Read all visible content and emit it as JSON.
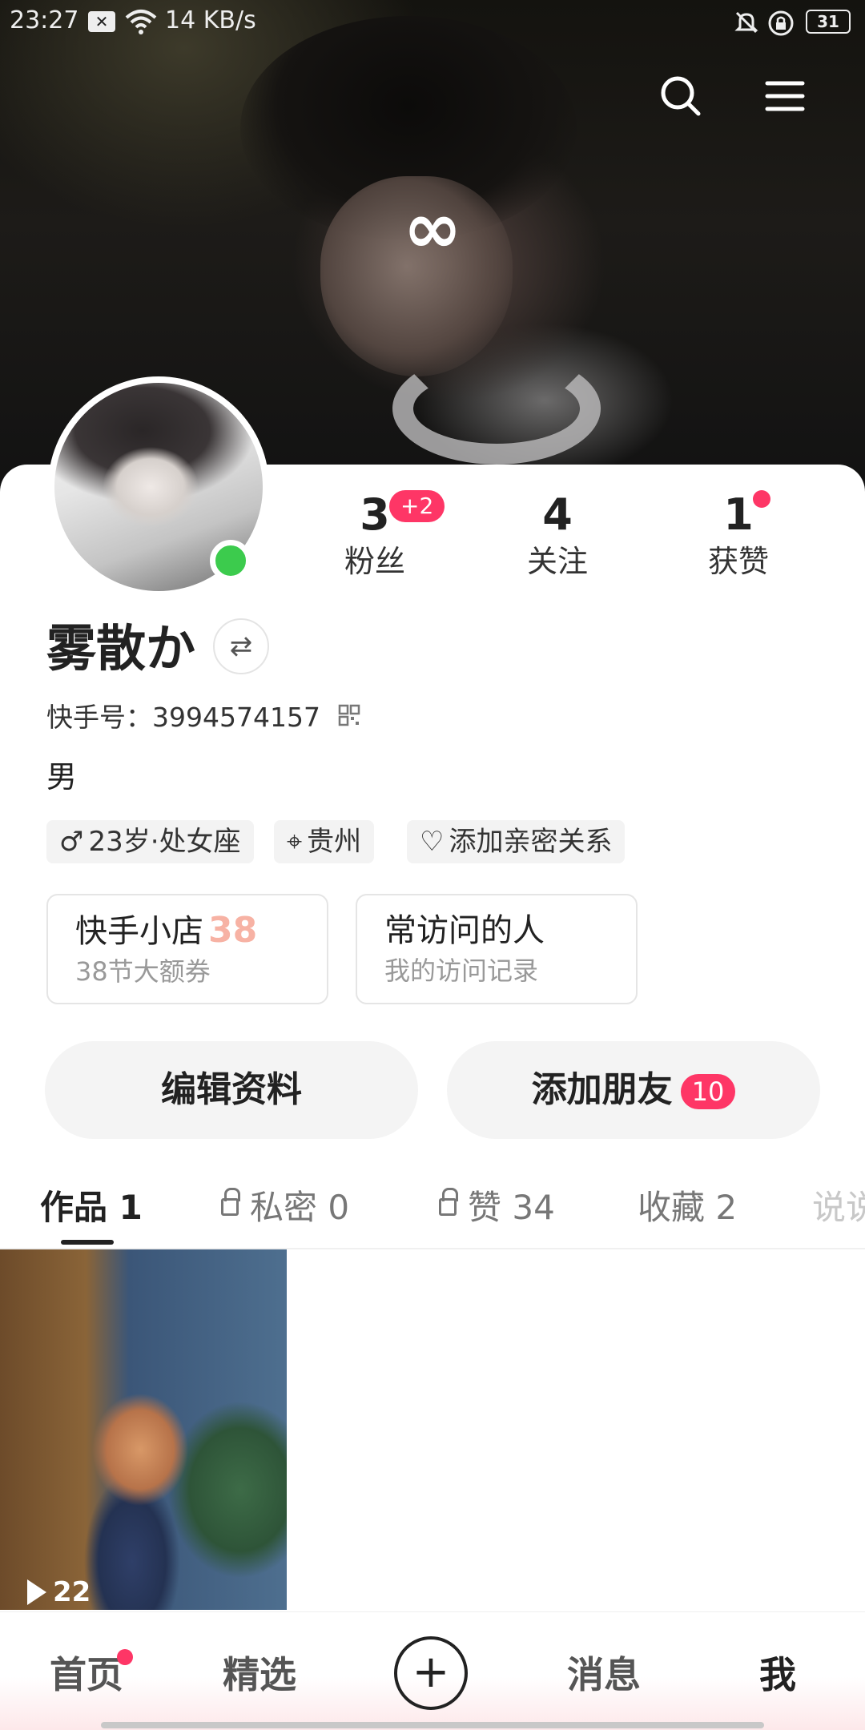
{
  "status_bar": {
    "time": "23:27",
    "speed": "14 KB/s",
    "battery": "31"
  },
  "header": {
    "logo_symbol": "∞",
    "search_icon": "search-icon",
    "menu_icon": "menu-icon"
  },
  "profile": {
    "username": "雾散か",
    "kuaishou_id": "快手号：3994574157",
    "gender": "男",
    "online": true
  },
  "stats": [
    {
      "value": "3",
      "label": "粉丝",
      "badge": "+2"
    },
    {
      "value": "4",
      "label": "关注"
    },
    {
      "value": "1",
      "label": "获赞",
      "dot": true
    }
  ],
  "chips": [
    {
      "icon": "♂",
      "text": "23岁·处女座"
    },
    {
      "icon": "⌖",
      "text": "贵州"
    },
    {
      "icon": "♡",
      "text": "添加亲密关系"
    }
  ],
  "features": [
    {
      "title": "快手小店",
      "subtitle": "38节大额券",
      "decoration": "38"
    },
    {
      "title": "常访问的人",
      "subtitle": "我的访问记录"
    }
  ],
  "actions": {
    "edit_profile": "编辑资料",
    "add_friend": "添加朋友",
    "add_friend_count": "10"
  },
  "tabs": [
    {
      "label": "作品 1",
      "active": true
    },
    {
      "label": "私密 0",
      "locked": true
    },
    {
      "label": "赞 34",
      "locked": true
    },
    {
      "label": "收藏 2"
    },
    {
      "label": "说说"
    }
  ],
  "works": [
    {
      "play_count": "22"
    }
  ],
  "bottom_nav": {
    "home": "首页",
    "featured": "精选",
    "messages": "消息",
    "me": "我"
  },
  "colors": {
    "accent": "#fe3666",
    "online": "#3ccb4d"
  }
}
